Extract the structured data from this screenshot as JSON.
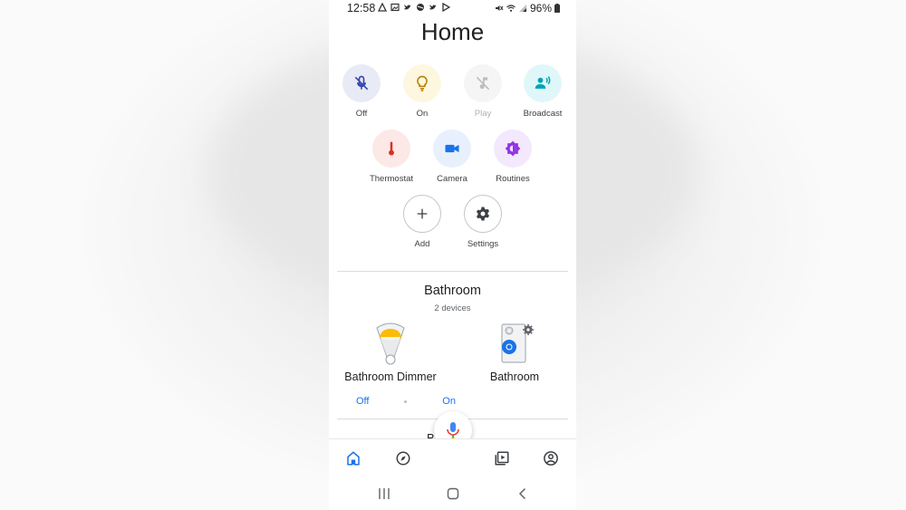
{
  "status_bar": {
    "time": "12:58",
    "battery": "96%"
  },
  "page": {
    "title": "Home"
  },
  "actions": [
    {
      "label": "Off",
      "icon": "mic-off-icon",
      "bg": "#e8eaf6",
      "fg": "#3949ab"
    },
    {
      "label": "On",
      "icon": "lightbulb-icon",
      "bg": "#fef7e0",
      "fg": "#c28a00"
    },
    {
      "label": "Play",
      "icon": "music-off-icon",
      "bg": "#f5f5f5",
      "fg": "#bdbdbd"
    },
    {
      "label": "Broadcast",
      "icon": "broadcast-icon",
      "bg": "#e0f7fa",
      "fg": "#00a3b4"
    },
    {
      "label": "Thermostat",
      "icon": "thermometer-icon",
      "bg": "#fce8e6",
      "fg": "#d93025"
    },
    {
      "label": "Camera",
      "icon": "camera-icon",
      "bg": "#e8f0fe",
      "fg": "#1a73e8"
    },
    {
      "label": "Routines",
      "icon": "routines-icon",
      "bg": "#f3e8fd",
      "fg": "#9334e6"
    },
    {
      "label": "Add",
      "icon": "plus-icon",
      "bg": "#ffffff",
      "fg": "#3c4043"
    },
    {
      "label": "Settings",
      "icon": "gear-icon",
      "bg": "#ffffff",
      "fg": "#3c4043"
    }
  ],
  "room": {
    "name": "Bathroom",
    "device_count": "2 devices",
    "devices": [
      {
        "name": "Bathroom Dimmer",
        "icon": "light-bulb-icon",
        "toggle_off": "Off",
        "toggle_on": "On"
      },
      {
        "name": "Bathroom",
        "icon": "speaker-icon"
      }
    ]
  },
  "next_room_peek": "B      m",
  "accent": "#1a73e8"
}
